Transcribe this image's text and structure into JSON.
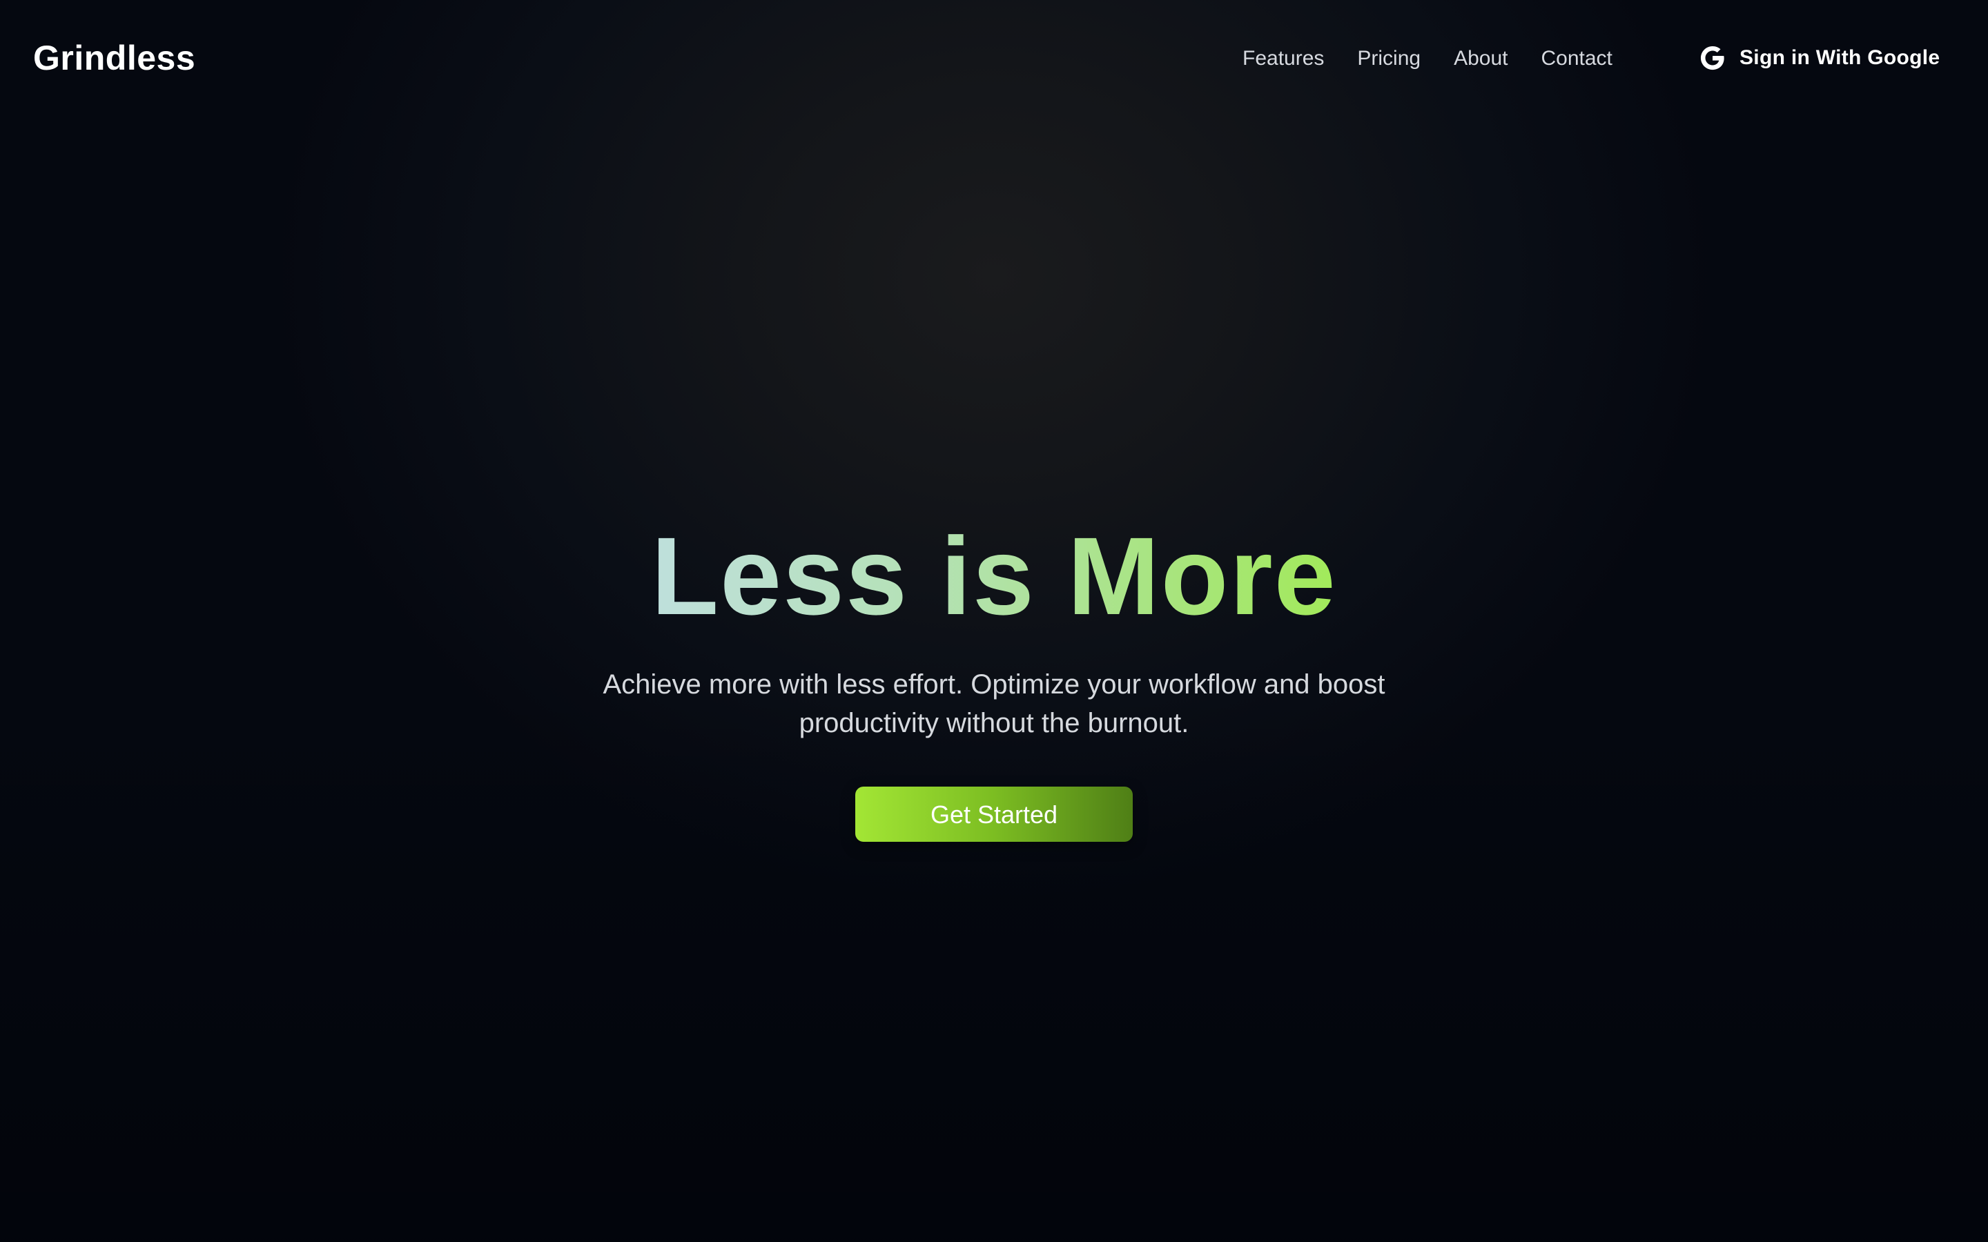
{
  "nav": {
    "brand": "Grindless",
    "links": [
      {
        "label": "Features"
      },
      {
        "label": "Pricing"
      },
      {
        "label": "About"
      },
      {
        "label": "Contact"
      }
    ],
    "signin": {
      "icon": "google-icon",
      "label": "Sign in With Google"
    }
  },
  "hero": {
    "title": "Less is More",
    "subtitle": "Achieve more with less effort. Optimize your workflow and boost productivity without the burnout.",
    "cta_label": "Get Started"
  },
  "colors": {
    "background": "#0a0e16",
    "title_gradient_start": "#bfe0dc",
    "title_gradient_end": "#a2ea5a",
    "cta_gradient_start": "#a3e635",
    "cta_gradient_end": "#4f7f16",
    "text_muted": "#d6d9de"
  }
}
